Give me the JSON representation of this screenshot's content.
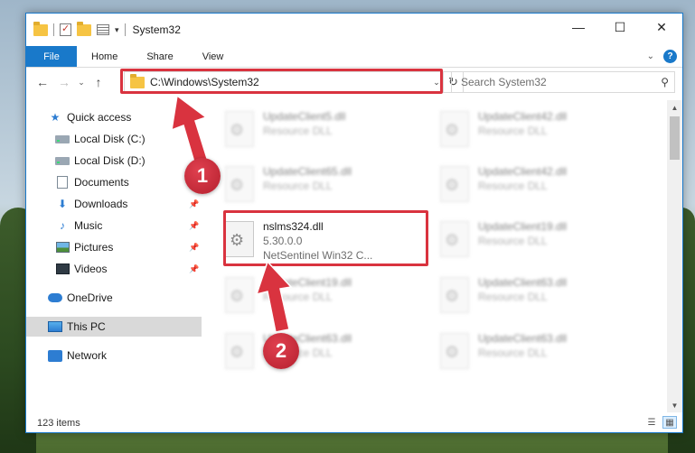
{
  "window": {
    "title": "System32",
    "controls": {
      "minimize": "—",
      "maximize": "☐",
      "close": "✕"
    }
  },
  "ribbon": {
    "tabs": [
      "File",
      "Home",
      "Share",
      "View"
    ],
    "help": "?"
  },
  "address_bar": {
    "path": "C:\\Windows\\System32",
    "search_placeholder": "Search System32"
  },
  "sidebar": {
    "items": [
      {
        "label": "Quick access",
        "icon": "star-icon"
      },
      {
        "label": "Local Disk (C:)",
        "icon": "drive-icon"
      },
      {
        "label": "Local Disk (D:)",
        "icon": "drive-icon"
      },
      {
        "label": "Documents",
        "icon": "documents-icon"
      },
      {
        "label": "Downloads",
        "icon": "download-arrow-icon"
      },
      {
        "label": "Music",
        "icon": "music-note-icon"
      },
      {
        "label": "Pictures",
        "icon": "pictures-icon"
      },
      {
        "label": "Videos",
        "icon": "videos-icon"
      },
      {
        "label": "OneDrive",
        "icon": "cloud-icon"
      },
      {
        "label": "This PC",
        "icon": "computer-icon",
        "selected": true
      },
      {
        "label": "Network",
        "icon": "network-icon"
      }
    ]
  },
  "files": [
    {
      "name": "UpdateClient5.dll",
      "sub": "Resource DLL",
      "blurred": true
    },
    {
      "name": "UpdateClient42.dll",
      "sub": "Resource DLL",
      "blurred": true
    },
    {
      "name": "UpdateClient65.dll",
      "sub": "Resource DLL",
      "blurred": true
    },
    {
      "name": "UpdateClient42.dll",
      "sub": "Resource DLL",
      "blurred": true
    },
    {
      "name": "nslms324.dll",
      "version": "5.30.0.0",
      "description": "NetSentinel Win32 C...",
      "blurred": false
    },
    {
      "name": "UpdateClient19.dll",
      "sub": "Resource DLL",
      "blurred": true
    },
    {
      "name": "UpdateClient19.dll",
      "sub": "Resource DLL",
      "blurred": true
    },
    {
      "name": "UpdateClient63.dll",
      "sub": "Resource DLL",
      "blurred": true
    },
    {
      "name": "UpdateClient63.dll",
      "sub": "Resource DLL",
      "blurred": true
    },
    {
      "name": "UpdateClient63.dll",
      "sub": "Resource DLL",
      "blurred": true
    }
  ],
  "status": {
    "item_count": "123 items"
  },
  "callouts": [
    "1",
    "2"
  ],
  "colors": {
    "accent": "#1979ca",
    "highlight": "#d9333f"
  }
}
